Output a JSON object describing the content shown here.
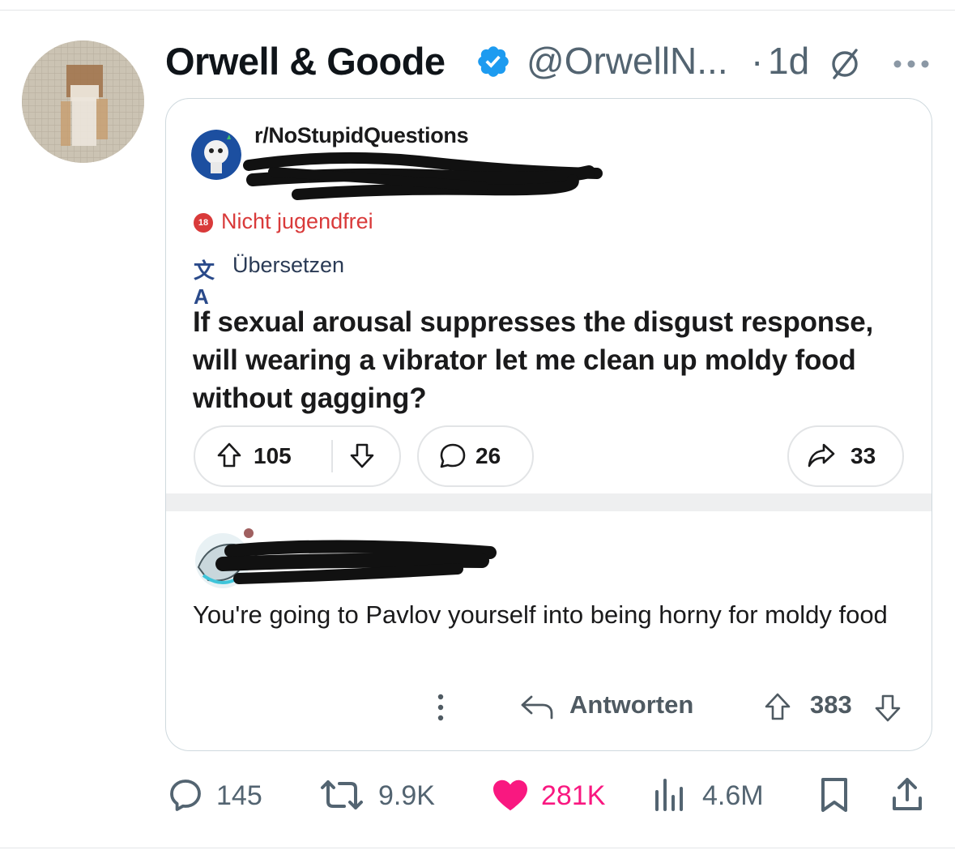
{
  "tweet": {
    "author_name": "Orwell & Goode",
    "handle": "@OrwellN...",
    "separator": "·",
    "time": "1d",
    "icons": [
      "verified-badge-icon",
      "grok-icon",
      "more-icon"
    ],
    "colors": {
      "verified": "#1d9bf0",
      "like": "#f91880",
      "muted": "#536471"
    }
  },
  "card": {
    "subreddit": "r/NoStupidQuestions",
    "nsfw_badge": "18",
    "nsfw_label": "Nicht jugendfrei",
    "translate_icon": "文A",
    "translate_label": "Übersetzen",
    "question": "If sexual arousal suppresses the disgust response, will wearing a vibrator let me clean up moldy food without gagging?",
    "votes": "105",
    "comments": "26",
    "shares": "33",
    "comment": {
      "text": "You're going to Pavlov yourself into being horny for moldy food",
      "reply_label": "Antworten",
      "score": "383"
    }
  },
  "actions": {
    "replies": "145",
    "reposts": "9.9K",
    "likes": "281K",
    "views": "4.6M"
  }
}
